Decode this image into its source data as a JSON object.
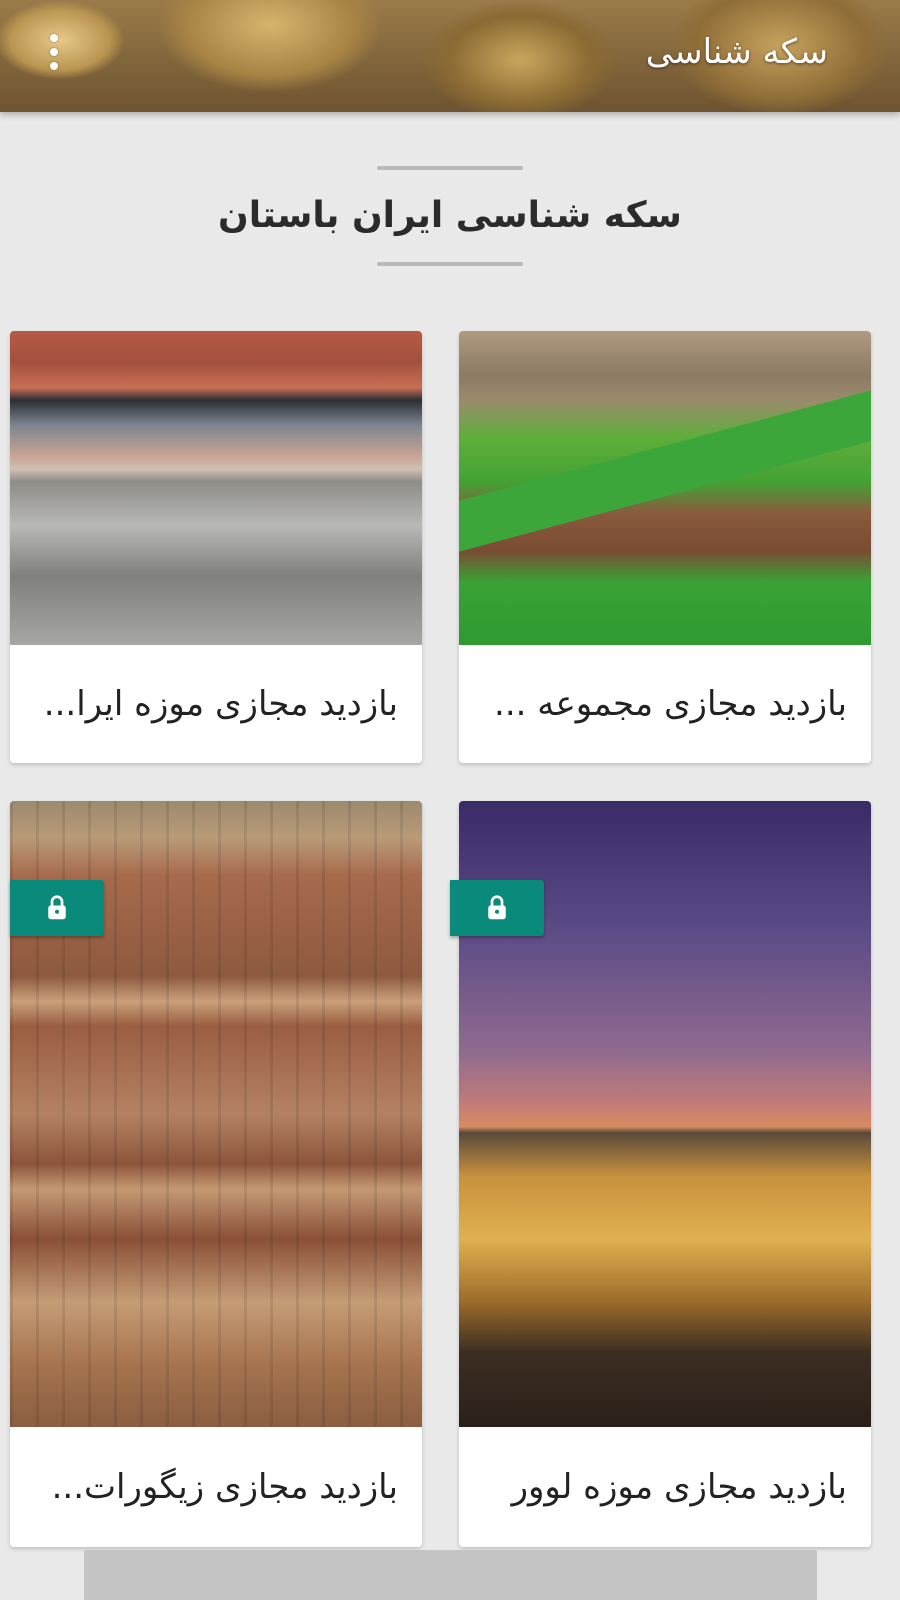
{
  "appbar": {
    "title": "سکه شناسی",
    "menu_icon": "more-vert-icon"
  },
  "section": {
    "title": "سکه شناسی ایران باستان"
  },
  "cards": [
    {
      "label": "بازدید مجازی مجموعه ...",
      "locked": false,
      "image": "green-fields-landscape"
    },
    {
      "label": "بازدید مجازی موزه ایرا...",
      "locked": false,
      "image": "museum-courtyard"
    },
    {
      "label": "بازدید مجازی موزه لوور",
      "locked": true,
      "image": "louvre-pyramid-night"
    },
    {
      "label": "بازدید مجازی زیگورات...",
      "locked": true,
      "image": "ziggurat"
    }
  ],
  "colors": {
    "accent": "#0a8a7a",
    "background": "#e9e9e9"
  },
  "icons": {
    "lock": "lock-icon"
  }
}
